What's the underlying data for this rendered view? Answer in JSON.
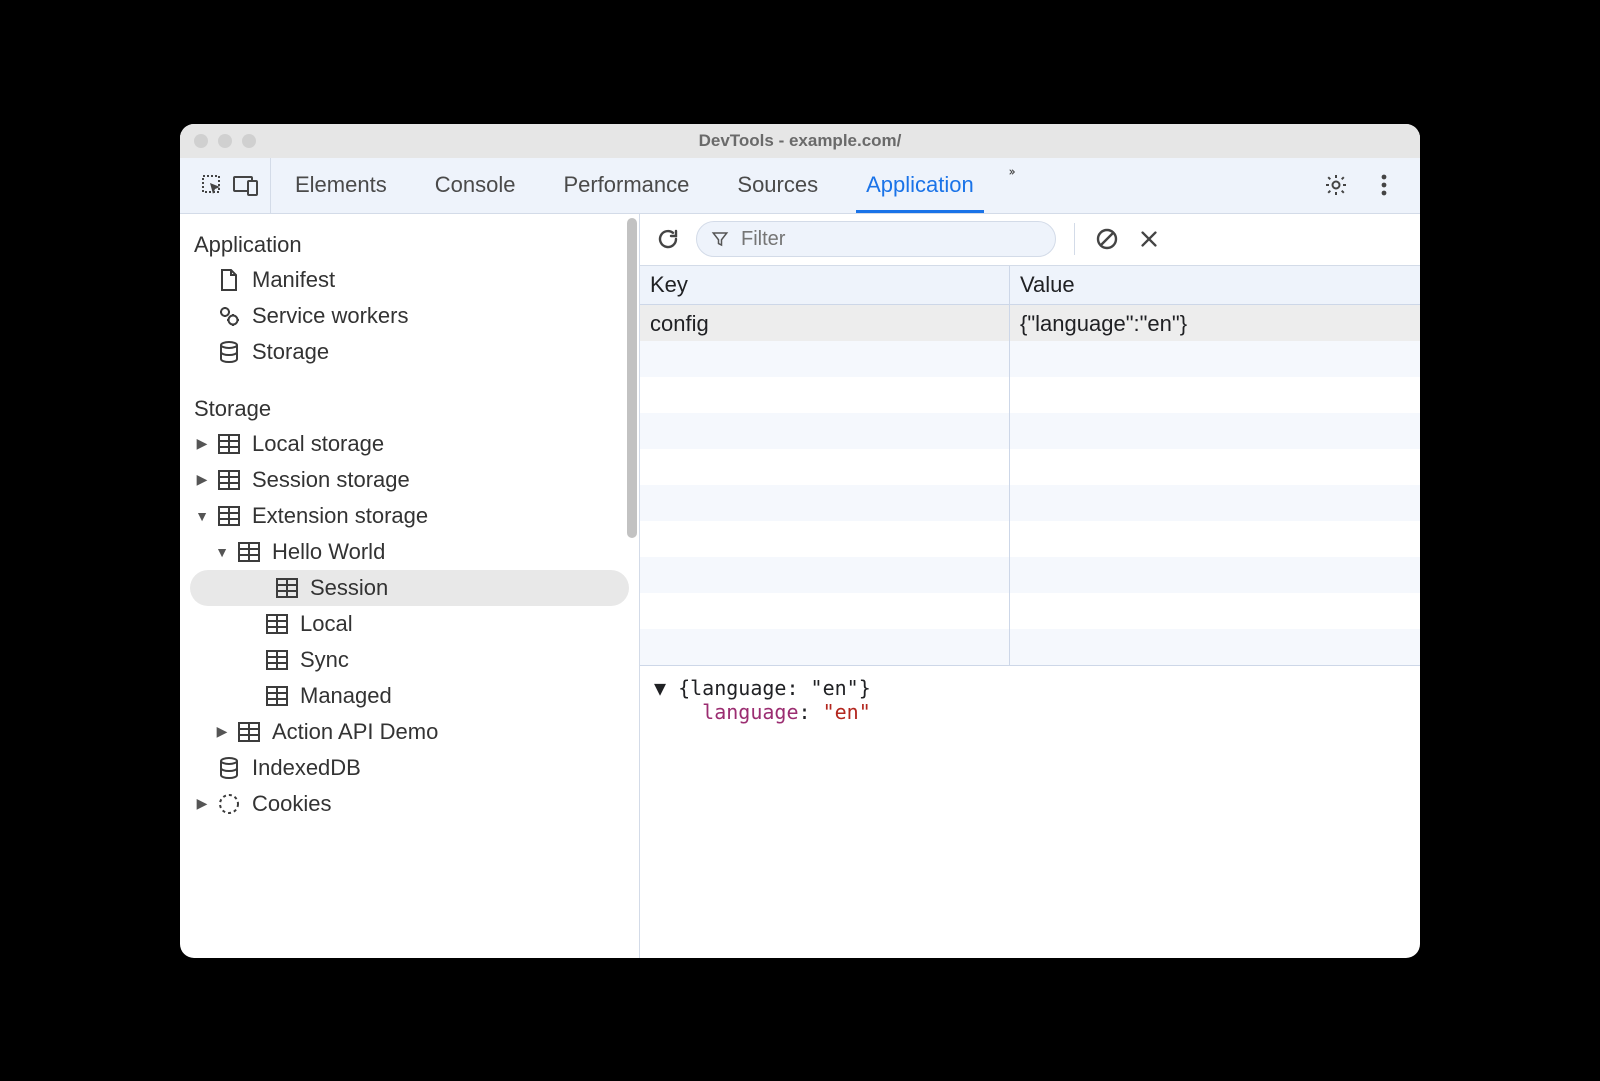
{
  "window": {
    "title": "DevTools - example.com/"
  },
  "tabs": {
    "items": [
      "Elements",
      "Console",
      "Performance",
      "Sources",
      "Application"
    ],
    "active_index": 4
  },
  "sidebar": {
    "sections": {
      "application": {
        "title": "Application",
        "items": [
          {
            "label": "Manifest",
            "icon": "file"
          },
          {
            "label": "Service workers",
            "icon": "gears"
          },
          {
            "label": "Storage",
            "icon": "database"
          }
        ]
      },
      "storage": {
        "title": "Storage",
        "local_storage": "Local storage",
        "session_storage": "Session storage",
        "extension_storage": "Extension storage",
        "hello_world": "Hello World",
        "ext_items": [
          "Session",
          "Local",
          "Sync",
          "Managed"
        ],
        "action_api_demo": "Action API Demo",
        "indexeddb": "IndexedDB",
        "cookies": "Cookies"
      }
    }
  },
  "toolbar": {
    "filter_placeholder": "Filter"
  },
  "table": {
    "headers": {
      "key": "Key",
      "value": "Value"
    },
    "rows": [
      {
        "key": "config",
        "value": "{\"language\":\"en\"}"
      }
    ]
  },
  "preview": {
    "summary": "{language: \"en\"}",
    "prop_key": "language",
    "prop_sep": ": ",
    "prop_value": "\"en\""
  }
}
